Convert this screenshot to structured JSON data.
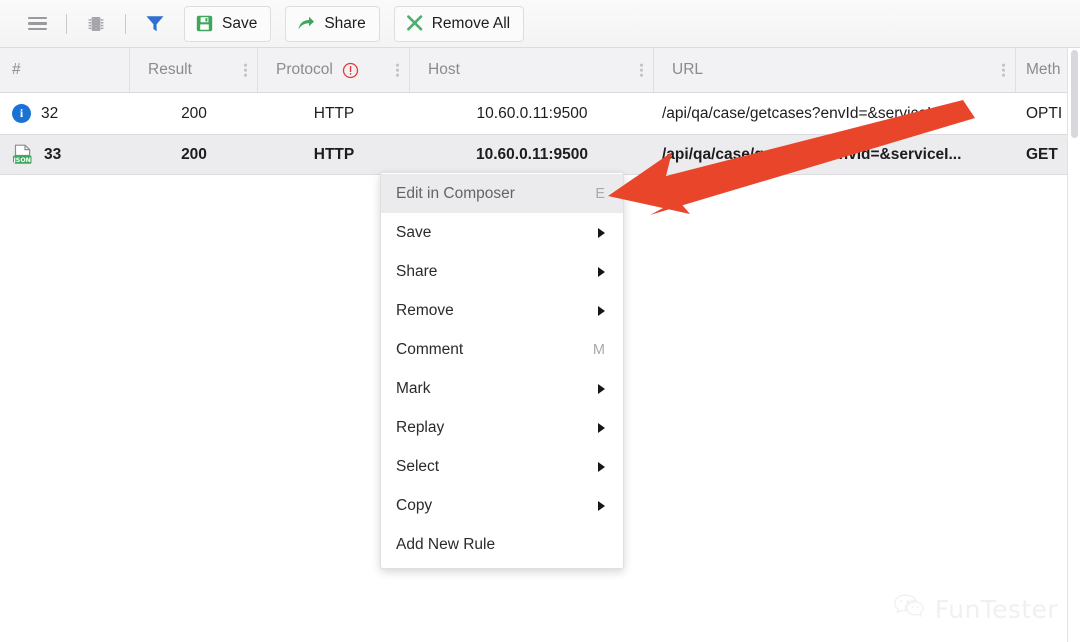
{
  "toolbar": {
    "icons": [
      {
        "name": "menu-icon",
        "label": "Menu"
      },
      {
        "name": "chip-icon",
        "label": "Interceptor"
      },
      {
        "name": "filter-icon",
        "label": "Filter"
      }
    ],
    "buttons": [
      {
        "name": "save-button",
        "label": "Save",
        "icon": "floppy-disk-icon",
        "color": "#3fa75c"
      },
      {
        "name": "share-button",
        "label": "Share",
        "icon": "share-arrow-icon",
        "color": "#3fa75c"
      },
      {
        "name": "remove-all-button",
        "label": "Remove All",
        "icon": "close-x-icon",
        "color": "#4caf6e"
      }
    ]
  },
  "table": {
    "columns": [
      {
        "key": "num",
        "label": "#",
        "has_menu": false,
        "warn": false
      },
      {
        "key": "result",
        "label": "Result",
        "has_menu": true,
        "warn": false
      },
      {
        "key": "protocol",
        "label": "Protocol",
        "has_menu": true,
        "warn": true
      },
      {
        "key": "host",
        "label": "Host",
        "has_menu": true,
        "warn": false
      },
      {
        "key": "url",
        "label": "URL",
        "has_menu": true,
        "warn": false
      },
      {
        "key": "method",
        "label": "Meth",
        "has_menu": false,
        "warn": false
      }
    ],
    "rows": [
      {
        "icon": "info-icon",
        "icon_text": "i",
        "num": "32",
        "result": "200",
        "protocol": "HTTP",
        "host": "10.60.0.11:9500",
        "url": "/api/qa/case/getcases?envId=&serviceI...",
        "method": "OPTI",
        "selected": false
      },
      {
        "icon": "json-file-icon",
        "icon_text": "JSON",
        "num": "33",
        "result": "200",
        "protocol": "HTTP",
        "host": "10.60.0.11:9500",
        "url": "/api/qa/case/getcases?envId=&serviceI...",
        "method": "GET",
        "selected": true
      }
    ]
  },
  "context_menu": {
    "items": [
      {
        "label": "Edit in Composer",
        "shortcut": "E",
        "submenu": false,
        "highlighted": true
      },
      {
        "label": "Save",
        "shortcut": "",
        "submenu": true,
        "highlighted": false
      },
      {
        "label": "Share",
        "shortcut": "",
        "submenu": true,
        "highlighted": false
      },
      {
        "label": "Remove",
        "shortcut": "",
        "submenu": true,
        "highlighted": false
      },
      {
        "label": "Comment",
        "shortcut": "M",
        "submenu": false,
        "highlighted": false
      },
      {
        "label": "Mark",
        "shortcut": "",
        "submenu": true,
        "highlighted": false
      },
      {
        "label": "Replay",
        "shortcut": "",
        "submenu": true,
        "highlighted": false
      },
      {
        "label": "Select",
        "shortcut": "",
        "submenu": true,
        "highlighted": false
      },
      {
        "label": "Copy",
        "shortcut": "",
        "submenu": true,
        "highlighted": false
      },
      {
        "label": "Add New Rule",
        "shortcut": "",
        "submenu": false,
        "highlighted": false
      }
    ]
  },
  "annotation": {
    "arrow_color": "#e8452b",
    "points_to": "Edit in Composer"
  },
  "watermark": {
    "text": "FunTester",
    "icon": "wechat-icon"
  },
  "colors": {
    "accent_green": "#3fa75c",
    "filter_blue": "#2f6fd0",
    "warn_red": "#e03b3b",
    "info_blue": "#1a73d4",
    "selected_row": "#ececee",
    "header_bg": "#f2f2f4"
  }
}
